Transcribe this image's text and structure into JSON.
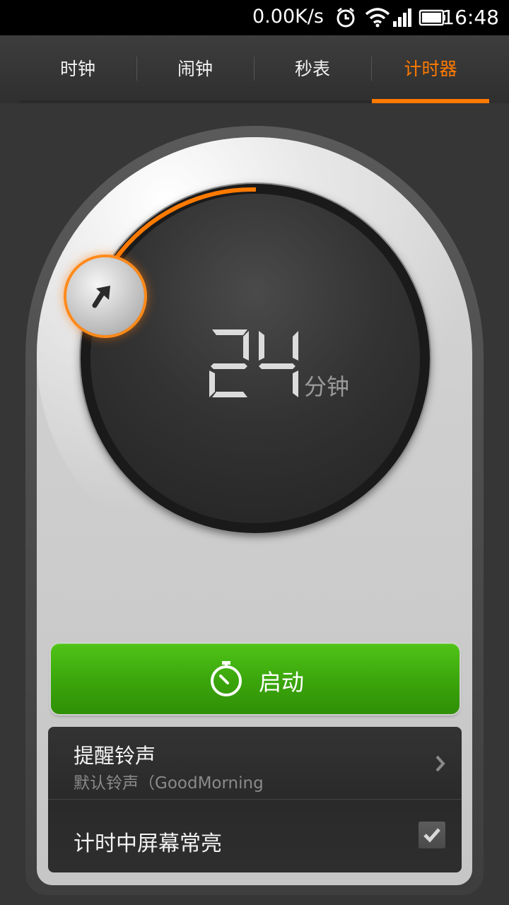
{
  "status_bar": {
    "net_speed": "0.00K/s",
    "time": "16:48",
    "icons": [
      "alarm-icon",
      "wifi-icon",
      "signal-icon",
      "battery-icon"
    ]
  },
  "tabs": [
    {
      "label": "时钟",
      "active": false
    },
    {
      "label": "闹钟",
      "active": false
    },
    {
      "label": "秒表",
      "active": false
    },
    {
      "label": "计时器",
      "active": true
    }
  ],
  "timer": {
    "value": "24",
    "unit": "分钟"
  },
  "start_button": {
    "label": "启动",
    "icon": "stopwatch-icon"
  },
  "settings": {
    "ringtone_title": "提醒铃声",
    "ringtone_value": "默认铃声（GoodMorning",
    "keep_screen_on": "计时中屏幕常亮",
    "keep_screen_on_checked": true
  },
  "colors": {
    "accent": "#ff7a00",
    "start_green": "#3ca70c"
  }
}
